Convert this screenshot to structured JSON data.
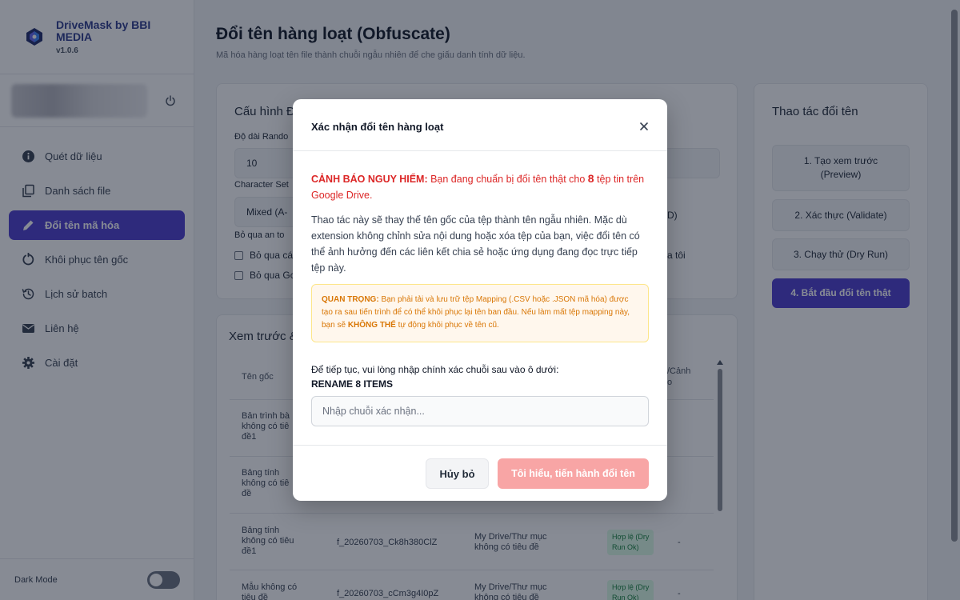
{
  "brand": {
    "name": "DriveMask by BBI MEDIA",
    "version": "v1.0.6"
  },
  "sidebar": {
    "items": [
      {
        "label": "Quét dữ liệu",
        "icon": "info-icon"
      },
      {
        "label": "Danh sách file",
        "icon": "copy-icon"
      },
      {
        "label": "Đổi tên mã hóa",
        "icon": "pencil-icon",
        "active": true
      },
      {
        "label": "Khôi phục tên gốc",
        "icon": "restore-icon"
      },
      {
        "label": "Lịch sử batch",
        "icon": "history-icon"
      },
      {
        "label": "Liên hệ",
        "icon": "mail-icon"
      },
      {
        "label": "Cài đặt",
        "icon": "gear-icon"
      }
    ],
    "dark_mode_label": "Dark Mode",
    "dark_mode_on": false
  },
  "page": {
    "title": "Đổi tên hàng loạt (Obfuscate)",
    "subtitle": "Mã hóa hàng loạt tên file thành chuỗi ngẫu nhiên để che giấu danh tính dữ liệu."
  },
  "config": {
    "title": "Cấu hình Đ",
    "random_length_label": "Độ dài Rando",
    "random_length_value": "10",
    "charset_label": "Character Set",
    "charset_value": "Mixed (A-",
    "charset_suffix": "D)",
    "skip_label": "Bỏ qua an to",
    "skip_option_1": "Bỏ qua cá",
    "skip_option_2": "Bỏ qua Gc",
    "skip_option_right": "a tôi"
  },
  "preview": {
    "title": "Xem trước &",
    "columns": [
      "Tên gốc",
      "/Cảnh\no"
    ],
    "rows": [
      {
        "original": "Bản trình bà\nkhông có tiê\nđề1",
        "new": "",
        "path": "",
        "status": ""
      },
      {
        "original": "Bảng tính\nkhông có tiê\nđề",
        "new": "",
        "path": "",
        "status": ""
      },
      {
        "original": "Bảng tính\nkhông có tiêu\nđề1",
        "new": "f_20260703_Ck8h380ClZ",
        "path": "My Drive/Thư mục\nkhông có tiêu đề",
        "status": "Hợp lệ (Dry\nRun Ok)",
        "extra": "-"
      },
      {
        "original": "Mẫu không có\ntiêu đề",
        "new": "f_20260703_cCm3g4I0pZ",
        "path": "My Drive/Thư mục\nkhông có tiêu đề",
        "status": "Hợp lệ (Dry\nRun Ok)",
        "extra": "-"
      }
    ]
  },
  "actions": {
    "title": "Thao tác đổi tên",
    "buttons": [
      "1. Tạo xem trước\n(Preview)",
      "2. Xác thực (Validate)",
      "3. Chạy thử (Dry Run)",
      "4. Bắt đầu đổi tên thật"
    ]
  },
  "modal": {
    "title": "Xác nhận đổi tên hàng loạt",
    "warning_strong": "CẢNH BÁO NGUY HIỂM:",
    "warning_pre": " Bạn đang chuẩn bị đổi tên thật cho ",
    "warning_count": "8",
    "warning_post": " tệp tin trên Google Drive.",
    "description": "Thao tác này sẽ thay thế tên gốc của tệp thành tên ngẫu nhiên. Mặc dù extension không chỉnh sửa nội dung hoặc xóa tệp của bạn, việc đổi tên có thể ảnh hưởng đến các liên kết chia sẻ hoặc ứng dụng đang đọc trực tiếp tệp này.",
    "important_strong": "QUAN TRỌNG:",
    "important_pre": " Bạn phải tải và lưu trữ tệp Mapping (.CSV hoặc .JSON mã hóa) được tạo ra sau tiến trình để có thể khôi phục lại tên ban đầu. Nếu làm mất tệp mapping này, bạn sẽ ",
    "important_emph": "KHÔNG THỂ",
    "important_post": " tự động khôi phục về tên cũ.",
    "prompt": "Để tiếp tục, vui lòng nhập chính xác chuỗi sau vào ô dưới:",
    "confirm_string": "RENAME 8 ITEMS",
    "input_value": "",
    "input_placeholder": "Nhập chuỗi xác nhận...",
    "cancel_label": "Hủy bỏ",
    "confirm_label": "Tôi hiểu, tiến hành đổi tên"
  },
  "colors": {
    "accent": "#4c3ccf",
    "danger": "#dc2626",
    "warning": "#d97706",
    "confirm_disabled": "#f8a5a5"
  }
}
